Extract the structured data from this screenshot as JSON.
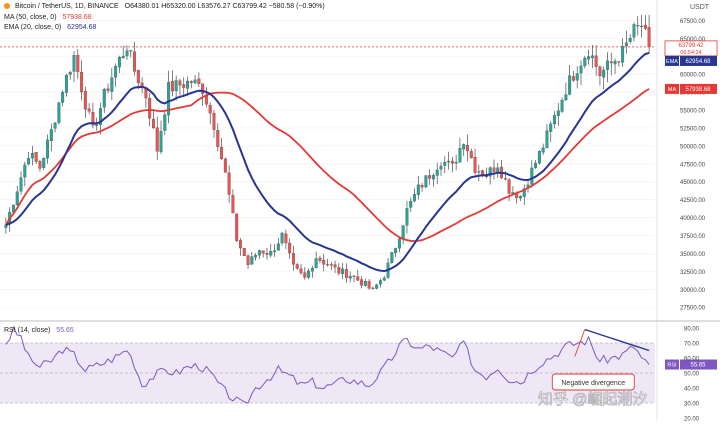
{
  "header": {
    "title": "Bitcoin / TetherUS, 1D, BINANCE",
    "ohlc": "O64380.01  H65320.00  L63576.27  C63799.42  −580.58 (−0.90%)",
    "ma_legend": "MA (50, close, 0)",
    "ma_value": "57938.68",
    "ema_legend": "EMA (20, close, 0)",
    "ema_value": "62954.68",
    "rsi_legend": "RSI (14, close)",
    "rsi_value": "55.65",
    "currency": "USDT"
  },
  "watermark": "知乎 @崛起潮汐",
  "colors": {
    "up": "#26a69a",
    "down": "#ef5350",
    "candle": "#4a4a4a",
    "ema": "#283593",
    "ma": "#e53935",
    "rsi": "#7e57c2",
    "rsi_band": "#ede7f6",
    "trend": "#283593",
    "annotation": "#e53935",
    "price_tag": "#e53935"
  },
  "chart_data": {
    "type": "candlestick",
    "price_axis": {
      "ticks": [
        "67500.00",
        "65000.00",
        "62500.00",
        "60000.00",
        "57500.00",
        "55000.00",
        "52500.00",
        "50000.00",
        "47500.00",
        "45000.00",
        "42500.00",
        "40000.00",
        "37500.00",
        "35000.00",
        "32500.00",
        "30000.00",
        "27500.00"
      ],
      "range": [
        26000,
        69500
      ]
    },
    "price_tags": [
      {
        "label": "63799.42",
        "sublabel": "06:54:24",
        "value": 63799.42,
        "kind": "last"
      },
      {
        "label": "EMA",
        "value_label": "62954.68",
        "value": 62954.68,
        "kind": "ema"
      },
      {
        "label": "MA",
        "value_label": "57938.68",
        "value": 57938.68,
        "kind": "ma"
      }
    ],
    "price_path": [
      [
        0,
        39000
      ],
      [
        3,
        44000
      ],
      [
        6,
        49000
      ],
      [
        9,
        47000
      ],
      [
        12,
        52000
      ],
      [
        15,
        58000
      ],
      [
        18,
        62500
      ],
      [
        21,
        56000
      ],
      [
        23,
        52000
      ],
      [
        26,
        57000
      ],
      [
        29,
        61000
      ],
      [
        32,
        64000
      ],
      [
        34,
        60500
      ],
      [
        37,
        57000
      ],
      [
        40,
        49500
      ],
      [
        43,
        58000
      ],
      [
        46,
        58500
      ],
      [
        49,
        59000
      ],
      [
        52,
        58000
      ],
      [
        55,
        53000
      ],
      [
        58,
        46000
      ],
      [
        61,
        37000
      ],
      [
        64,
        33500
      ],
      [
        67,
        35500
      ],
      [
        70,
        35000
      ],
      [
        73,
        37500
      ],
      [
        76,
        33000
      ],
      [
        79,
        31500
      ],
      [
        82,
        34500
      ],
      [
        85,
        33500
      ],
      [
        88,
        32500
      ],
      [
        91,
        32000
      ],
      [
        94,
        31000
      ],
      [
        97,
        29800
      ],
      [
        100,
        32000
      ],
      [
        103,
        36000
      ],
      [
        106,
        41000
      ],
      [
        109,
        44000
      ],
      [
        112,
        46000
      ],
      [
        115,
        48000
      ],
      [
        118,
        47000
      ],
      [
        121,
        51000
      ],
      [
        124,
        47000
      ],
      [
        127,
        46000
      ],
      [
        130,
        47500
      ],
      [
        133,
        44000
      ],
      [
        136,
        43000
      ],
      [
        139,
        46500
      ],
      [
        142,
        50000
      ],
      [
        145,
        54000
      ],
      [
        148,
        58000
      ],
      [
        151,
        61000
      ],
      [
        154,
        63500
      ],
      [
        157,
        60000
      ],
      [
        160,
        61500
      ],
      [
        163,
        63000
      ],
      [
        166,
        66000
      ],
      [
        168,
        66800
      ],
      [
        170,
        63800
      ]
    ],
    "ema": {
      "name": "EMA (20, close, 0)",
      "period": 20
    },
    "ma": {
      "name": "MA (50, close, 0)",
      "period": 50
    },
    "rsi": {
      "name": "RSI (14, close)",
      "ticks": [
        "80.00",
        "70.00",
        "60.00",
        "50.00",
        "40.00",
        "30.00",
        "20.00"
      ],
      "range": [
        18,
        84
      ],
      "band": [
        30,
        70
      ],
      "midline": 50,
      "path": [
        [
          0,
          70
        ],
        [
          2,
          78
        ],
        [
          4,
          74
        ],
        [
          6,
          60
        ],
        [
          9,
          54
        ],
        [
          12,
          58
        ],
        [
          15,
          66
        ],
        [
          18,
          62
        ],
        [
          21,
          52
        ],
        [
          24,
          55
        ],
        [
          27,
          58
        ],
        [
          30,
          62
        ],
        [
          32,
          66
        ],
        [
          34,
          56
        ],
        [
          36,
          42
        ],
        [
          39,
          48
        ],
        [
          42,
          52
        ],
        [
          45,
          50
        ],
        [
          48,
          54
        ],
        [
          51,
          55
        ],
        [
          54,
          50
        ],
        [
          57,
          40
        ],
        [
          60,
          33
        ],
        [
          63,
          28
        ],
        [
          66,
          40
        ],
        [
          69,
          46
        ],
        [
          72,
          52
        ],
        [
          75,
          48
        ],
        [
          78,
          42
        ],
        [
          81,
          44
        ],
        [
          84,
          40
        ],
        [
          87,
          43
        ],
        [
          90,
          46
        ],
        [
          93,
          44
        ],
        [
          96,
          42
        ],
        [
          99,
          50
        ],
        [
          102,
          60
        ],
        [
          104,
          68
        ],
        [
          106,
          72
        ],
        [
          109,
          66
        ],
        [
          112,
          68
        ],
        [
          115,
          64
        ],
        [
          118,
          60
        ],
        [
          121,
          70
        ],
        [
          124,
          52
        ],
        [
          127,
          48
        ],
        [
          130,
          54
        ],
        [
          133,
          46
        ],
        [
          136,
          44
        ],
        [
          139,
          52
        ],
        [
          142,
          58
        ],
        [
          145,
          62
        ],
        [
          148,
          68
        ],
        [
          151,
          70
        ],
        [
          154,
          72
        ],
        [
          157,
          58
        ],
        [
          160,
          60
        ],
        [
          163,
          62
        ],
        [
          166,
          68
        ],
        [
          168,
          60
        ],
        [
          170,
          55.65
        ]
      ]
    },
    "annotations": [
      {
        "text": "Negative divergence",
        "kind": "label"
      },
      {
        "text": "",
        "kind": "trendline",
        "from": [
          153,
          79
        ],
        "to": [
          170,
          65
        ]
      }
    ]
  }
}
